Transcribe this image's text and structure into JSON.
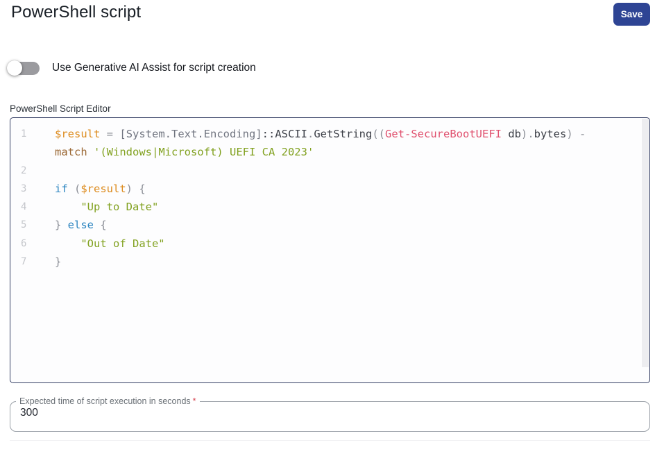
{
  "header": {
    "title": "PowerShell script",
    "save_label": "Save",
    "save_bg": "#2e4494"
  },
  "toggle": {
    "label": "Use Generative AI Assist for script creation",
    "state": "off"
  },
  "editor": {
    "label": "PowerShell Script Editor",
    "colors": {
      "variable": "#dd8c1f",
      "operator": "#8b8e96",
      "type": "#717580",
      "member": "#3b3e46",
      "plain": "#3b3e46",
      "cmdlet": "#e0506e",
      "keyword": "#2e86c1",
      "string": "#81a11f",
      "param": "#9a6733",
      "lineno": "#c4c6cb"
    },
    "rows": [
      {
        "num": "1",
        "tokens": [
          {
            "t": "$result",
            "c": "variable"
          },
          {
            "t": " ",
            "c": "plain"
          },
          {
            "t": "=",
            "c": "operator"
          },
          {
            "t": " ",
            "c": "plain"
          },
          {
            "t": "[System.Text.Encoding]",
            "c": "type"
          },
          {
            "t": "::ASCII",
            "c": "member"
          },
          {
            "t": ".",
            "c": "operator"
          },
          {
            "t": "GetString",
            "c": "member"
          },
          {
            "t": "((",
            "c": "operator"
          },
          {
            "t": "Get-SecureBootUEFI",
            "c": "cmdlet"
          },
          {
            "t": " db",
            "c": "member"
          },
          {
            "t": ").",
            "c": "operator"
          },
          {
            "t": "bytes",
            "c": "member"
          },
          {
            "t": ")",
            "c": "operator"
          },
          {
            "t": " -",
            "c": "operator"
          }
        ]
      },
      {
        "num": "",
        "tokens": [
          {
            "t": "match",
            "c": "param"
          },
          {
            "t": " ",
            "c": "plain"
          },
          {
            "t": "'(Windows|Microsoft) UEFI CA 2023'",
            "c": "string"
          }
        ]
      },
      {
        "num": "2",
        "tokens": []
      },
      {
        "num": "3",
        "tokens": [
          {
            "t": "if",
            "c": "keyword"
          },
          {
            "t": " (",
            "c": "operator"
          },
          {
            "t": "$result",
            "c": "variable"
          },
          {
            "t": ") {",
            "c": "operator"
          }
        ]
      },
      {
        "num": "4",
        "tokens": [
          {
            "t": "    ",
            "c": "plain"
          },
          {
            "t": "\"Up to Date\"",
            "c": "string"
          }
        ]
      },
      {
        "num": "5",
        "tokens": [
          {
            "t": "} ",
            "c": "operator"
          },
          {
            "t": "else",
            "c": "keyword"
          },
          {
            "t": " {",
            "c": "operator"
          }
        ]
      },
      {
        "num": "6",
        "tokens": [
          {
            "t": "    ",
            "c": "plain"
          },
          {
            "t": "\"Out of Date\"",
            "c": "string"
          }
        ]
      },
      {
        "num": "7",
        "tokens": [
          {
            "t": "}",
            "c": "operator"
          }
        ]
      }
    ]
  },
  "time_field": {
    "label": "Expected time of script execution in seconds",
    "required_marker": "*",
    "value": "300"
  }
}
